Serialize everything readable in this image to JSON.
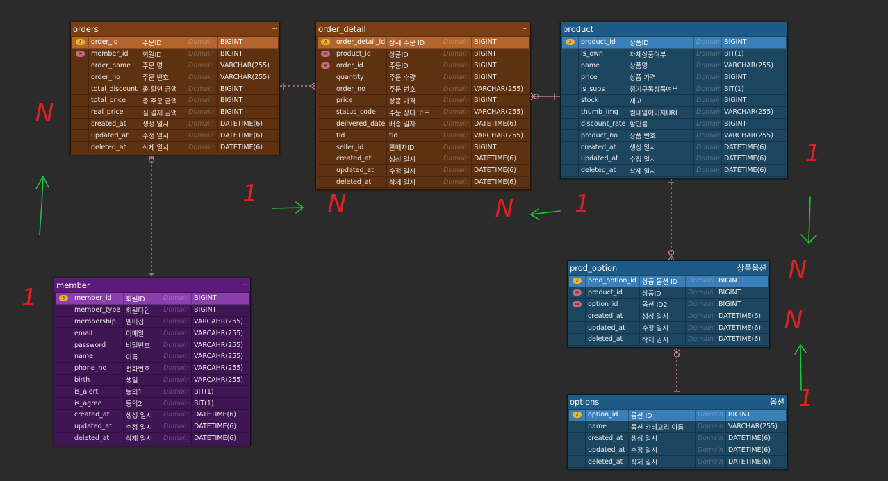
{
  "tables": [
    {
      "id": "orders",
      "name": "orders",
      "logical": "",
      "menu": "...",
      "colors": {
        "head": "#7a3e12",
        "body": "#5e3211",
        "pk": "#b3652d"
      },
      "rows": [
        {
          "key": "pk",
          "col": "order_id",
          "logical": "주문ID",
          "domain": "Domain",
          "type": "BIGINT"
        },
        {
          "key": "fk",
          "col": "member_id",
          "logical": "회원ID",
          "domain": "Domain",
          "type": "BIGINT"
        },
        {
          "key": "",
          "col": "order_name",
          "logical": "주문 명",
          "domain": "Domain",
          "type": "VARCHAR(255)"
        },
        {
          "key": "",
          "col": "order_no",
          "logical": "주문 번호",
          "domain": "Domain",
          "type": "VARCHAR(255)"
        },
        {
          "key": "",
          "col": "total_discount",
          "logical": "총 할인 금액",
          "domain": "Domain",
          "type": "BIGINT"
        },
        {
          "key": "",
          "col": "total_price",
          "logical": "총 주문 금액",
          "domain": "Domain",
          "type": "BIGINT"
        },
        {
          "key": "",
          "col": "real_price",
          "logical": "실 결제 금액",
          "domain": "Domain",
          "type": "BIGINT"
        },
        {
          "key": "",
          "col": "created_at",
          "logical": "생성 일시",
          "domain": "Domain",
          "type": "DATETIME(6)"
        },
        {
          "key": "",
          "col": "updated_at",
          "logical": "수정 일시",
          "domain": "Domain",
          "type": "DATETIME(6)"
        },
        {
          "key": "",
          "col": "deleted_at",
          "logical": "삭제 일시",
          "domain": "Domain",
          "type": "DATETIME(6)"
        }
      ]
    },
    {
      "id": "order_detail",
      "name": "order_detail",
      "logical": "",
      "menu": "...",
      "colors": {
        "head": "#7a3e12",
        "body": "#5e3211",
        "pk": "#b3652d"
      },
      "rows": [
        {
          "key": "pk",
          "col": "order_detail_id",
          "logical": "상세 주문 ID",
          "domain": "Domain",
          "type": "BIGINT"
        },
        {
          "key": "fk",
          "col": "product_id",
          "logical": "상품ID",
          "domain": "Domain",
          "type": "BIGINT"
        },
        {
          "key": "fk",
          "col": "order_id",
          "logical": "주문ID",
          "domain": "Domain",
          "type": "BIGINT"
        },
        {
          "key": "",
          "col": "quantity",
          "logical": "주문 수량",
          "domain": "Domain",
          "type": "BIGINT"
        },
        {
          "key": "",
          "col": "order_no",
          "logical": "주문 번호",
          "domain": "Domain",
          "type": "VARCHAR(255)"
        },
        {
          "key": "",
          "col": "price",
          "logical": "상품 가격",
          "domain": "Domain",
          "type": "BIGINT"
        },
        {
          "key": "",
          "col": "status_code",
          "logical": "주문 상태 코드",
          "domain": "Domain",
          "type": "VARCHAR(255)"
        },
        {
          "key": "",
          "col": "deilvered_date",
          "logical": "배송 일자",
          "domain": "Domain",
          "type": "DATETIME(6)"
        },
        {
          "key": "",
          "col": "tid",
          "logical": "tid",
          "domain": "Domain",
          "type": "VARCHAR(255)"
        },
        {
          "key": "",
          "col": "seller_id",
          "logical": "판매자ID",
          "domain": "Domain",
          "type": "BIGINT"
        },
        {
          "key": "",
          "col": "created_at",
          "logical": "생성 일시",
          "domain": "Domain",
          "type": "DATETIME(6)"
        },
        {
          "key": "",
          "col": "updated_at",
          "logical": "수정 일시",
          "domain": "Domain",
          "type": "DATETIME(6)"
        },
        {
          "key": "",
          "col": "deleted_at",
          "logical": "삭제 일시",
          "domain": "Domain",
          "type": "DATETIME(6)"
        }
      ]
    },
    {
      "id": "product",
      "name": "product",
      "logical": "",
      "menu": ".",
      "colors": {
        "head": "#1e5a86",
        "body": "#1d4660",
        "pk": "#3a7fb8"
      },
      "rows": [
        {
          "key": "pk",
          "col": "product_id",
          "logical": "상품ID",
          "domain": "Domain",
          "type": "BIGINT"
        },
        {
          "key": "",
          "col": "is_own",
          "logical": "자체상품여부",
          "domain": "Domain",
          "type": "BIT(1)"
        },
        {
          "key": "",
          "col": "name",
          "logical": "상품명",
          "domain": "Domain",
          "type": "VARCHAR(255)"
        },
        {
          "key": "",
          "col": "price",
          "logical": "상품 가격",
          "domain": "Domain",
          "type": "BIGINT"
        },
        {
          "key": "",
          "col": "is_subs",
          "logical": "정기구독상품여부",
          "domain": "Domain",
          "type": "BIT(1)"
        },
        {
          "key": "",
          "col": "stock",
          "logical": "재고",
          "domain": "Domain",
          "type": "BIGINT"
        },
        {
          "key": "",
          "col": "thumb_img",
          "logical": "썸네일이미지URL",
          "domain": "Domain",
          "type": "VARCHAR(255)"
        },
        {
          "key": "",
          "col": "discount_rate",
          "logical": "할인률",
          "domain": "Domain",
          "type": "BIGINT"
        },
        {
          "key": "",
          "col": "product_no",
          "logical": "상품 번호",
          "domain": "Domain",
          "type": "VARCHAR(255)"
        },
        {
          "key": "",
          "col": "created_at",
          "logical": "생성 일시",
          "domain": "Domain",
          "type": "DATETIME(6)"
        },
        {
          "key": "",
          "col": "updated_at",
          "logical": "수정 일시",
          "domain": "Domain",
          "type": "DATETIME(6)"
        },
        {
          "key": "",
          "col": "deleted_at",
          "logical": "삭제 일시",
          "domain": "Domain",
          "type": "DATETIME(6)"
        }
      ]
    },
    {
      "id": "member",
      "name": "member",
      "logical": "",
      "menu": "...",
      "colors": {
        "head": "#5c1a7a",
        "body": "#401553",
        "pk": "#8a3fac"
      },
      "rows": [
        {
          "key": "pk",
          "col": "member_id",
          "logical": "회원ID",
          "domain": "Domain",
          "type": "BIGINT"
        },
        {
          "key": "",
          "col": "member_type",
          "logical": "회원타입",
          "domain": "Domain",
          "type": "BIGINT"
        },
        {
          "key": "",
          "col": "membership",
          "logical": "멤버십",
          "domain": "Domain",
          "type": "VARCAHR(255)"
        },
        {
          "key": "",
          "col": "email",
          "logical": "이메일",
          "domain": "Domain",
          "type": "VARCAHR(255)"
        },
        {
          "key": "",
          "col": "password",
          "logical": "비밀번호",
          "domain": "Domain",
          "type": "VARCAHR(255)"
        },
        {
          "key": "",
          "col": "name",
          "logical": "이름",
          "domain": "Domain",
          "type": "VARCAHR(255)"
        },
        {
          "key": "",
          "col": "phone_no",
          "logical": "전화번호",
          "domain": "Domain",
          "type": "VARCAHR(255)"
        },
        {
          "key": "",
          "col": "birth",
          "logical": "생일",
          "domain": "Domain",
          "type": "VARCAHR(255)"
        },
        {
          "key": "",
          "col": "is_alert",
          "logical": "동의1",
          "domain": "Domain",
          "type": "BIT(1)"
        },
        {
          "key": "",
          "col": "is_agree",
          "logical": "동의2",
          "domain": "Domain",
          "type": "BIT(1)"
        },
        {
          "key": "",
          "col": "created_at",
          "logical": "생성 일시",
          "domain": "Domain",
          "type": "DATETIME(6)"
        },
        {
          "key": "",
          "col": "updated_at",
          "logical": "수정 일시",
          "domain": "Domain",
          "type": "DATETIME(6)"
        },
        {
          "key": "",
          "col": "deleted_at",
          "logical": "삭제 일시",
          "domain": "Domain",
          "type": "DATETIME(6)"
        }
      ]
    },
    {
      "id": "prod_option",
      "name": "prod_option",
      "logical": "상품옵션",
      "menu": "",
      "colors": {
        "head": "#1e5a86",
        "body": "#1d4660",
        "pk": "#3a7fb8"
      },
      "rows": [
        {
          "key": "pk",
          "col": "prod_option_id",
          "logical": "상품 옵션 ID",
          "domain": "Domain",
          "type": "BIGINT"
        },
        {
          "key": "fk",
          "col": "product_id",
          "logical": "상품ID",
          "domain": "Domain",
          "type": "BIGINT"
        },
        {
          "key": "fk",
          "col": "option_id",
          "logical": "옵션 ID2",
          "domain": "Domain",
          "type": "BIGINT"
        },
        {
          "key": "",
          "col": "created_at",
          "logical": "생성 일시",
          "domain": "Domain",
          "type": "DATETIME(6)"
        },
        {
          "key": "",
          "col": "updated_at",
          "logical": "수정 일시",
          "domain": "Domain",
          "type": "DATETIME(6)"
        },
        {
          "key": "",
          "col": "deleted_at",
          "logical": "삭제 일시",
          "domain": "Domain",
          "type": "DATETIME(6)"
        }
      ]
    },
    {
      "id": "options",
      "name": "options",
      "logical": "옵션",
      "menu": "",
      "colors": {
        "head": "#1e5a86",
        "body": "#1d4660",
        "pk": "#3a7fb8"
      },
      "rows": [
        {
          "key": "pk",
          "col": "option_id",
          "logical": "옵션 ID",
          "domain": "Domain",
          "type": "BIGINT"
        },
        {
          "key": "",
          "col": "name",
          "logical": "옵션 카테고리 이름",
          "domain": "Domain",
          "type": "VARCHAR(255)"
        },
        {
          "key": "",
          "col": "created_at",
          "logical": "생성 일시",
          "domain": "Domain",
          "type": "DATETIME(6)"
        },
        {
          "key": "",
          "col": "updated_at",
          "logical": "수정 일시",
          "domain": "Domain",
          "type": "DATETIME(6)"
        },
        {
          "key": "",
          "col": "deleted_at",
          "logical": "삭제 일시",
          "domain": "Domain",
          "type": "DATETIME(6)"
        }
      ]
    }
  ],
  "relationships": [
    {
      "from": "orders",
      "to": "member"
    },
    {
      "from": "orders",
      "to": "order_detail"
    },
    {
      "from": "order_detail",
      "to": "product"
    },
    {
      "from": "product",
      "to": "prod_option"
    },
    {
      "from": "prod_option",
      "to": "options"
    }
  ],
  "annotations": {
    "red_color": "#e0201f",
    "green_color": "#22c23a",
    "relation_color": "#d88b95",
    "red_labels": [
      "N",
      "1",
      "N",
      "N",
      "1",
      "1",
      "N",
      "N",
      "1",
      "1"
    ]
  }
}
